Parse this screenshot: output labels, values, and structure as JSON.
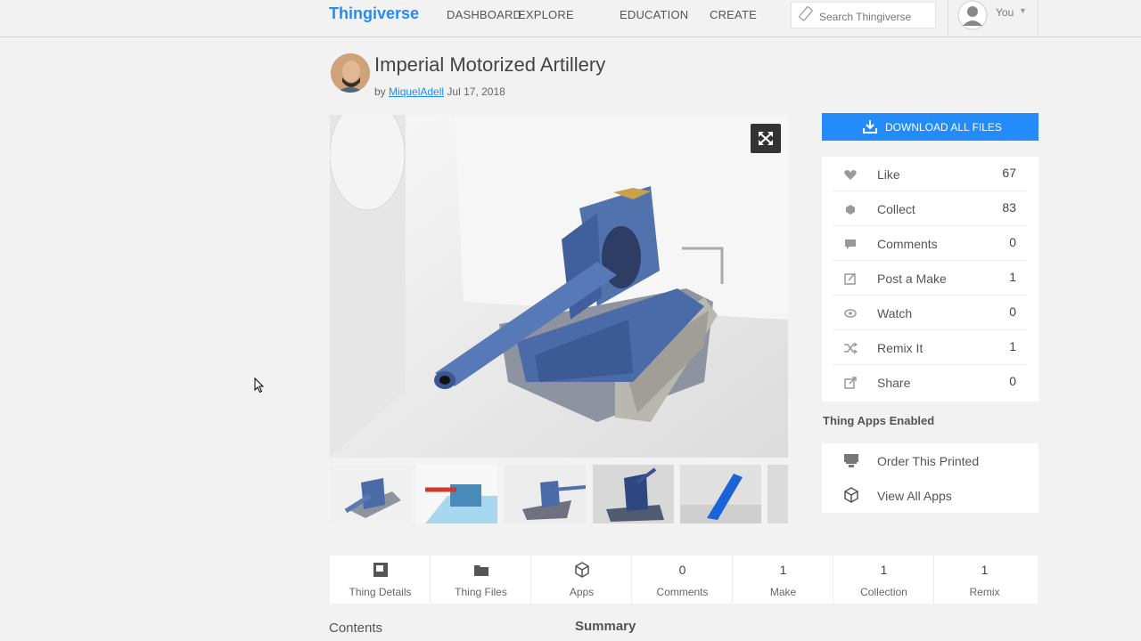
{
  "nav": {
    "logo": "Thingiverse",
    "items": [
      "DASHBOARD",
      "EXPLORE",
      "EDUCATION",
      "CREATE"
    ],
    "search_placeholder": "Search Thingiverse",
    "user_label": "You"
  },
  "thing": {
    "title": "Imperial Motorized Artillery",
    "by": "by",
    "author": "MiquelAdell",
    "date": "Jul 17, 2018"
  },
  "download": {
    "label": "DOWNLOAD ALL FILES"
  },
  "stats": [
    {
      "icon": "heart-icon",
      "label": "Like",
      "count": "67"
    },
    {
      "icon": "collect-icon",
      "label": "Collect",
      "count": "83"
    },
    {
      "icon": "comments-icon",
      "label": "Comments",
      "count": "0"
    },
    {
      "icon": "post-make-icon",
      "label": "Post a Make",
      "count": "1"
    },
    {
      "icon": "eye-icon",
      "label": "Watch",
      "count": "0"
    },
    {
      "icon": "shuffle-icon",
      "label": "Remix It",
      "count": "1"
    },
    {
      "icon": "share-icon",
      "label": "Share",
      "count": "0"
    }
  ],
  "apps": {
    "heading": "Thing Apps Enabled",
    "items": [
      {
        "icon": "printer-icon",
        "label": "Order This Printed"
      },
      {
        "icon": "cube-icon",
        "label": "View All Apps"
      }
    ]
  },
  "tabs": [
    {
      "icon": "thing-details-icon",
      "label": "Thing Details"
    },
    {
      "icon": "folder-icon",
      "label": "Thing Files"
    },
    {
      "icon": "cube-icon",
      "label": "Apps"
    },
    {
      "number": "0",
      "label": "Comments"
    },
    {
      "number": "1",
      "label": "Make"
    },
    {
      "number": "1",
      "label": "Collection"
    },
    {
      "number": "1",
      "label": "Remix"
    }
  ],
  "sections": {
    "contents": "Contents",
    "summary": "Summary"
  },
  "colors": {
    "accent": "#248bfb",
    "tank": "#4a6aa8"
  }
}
